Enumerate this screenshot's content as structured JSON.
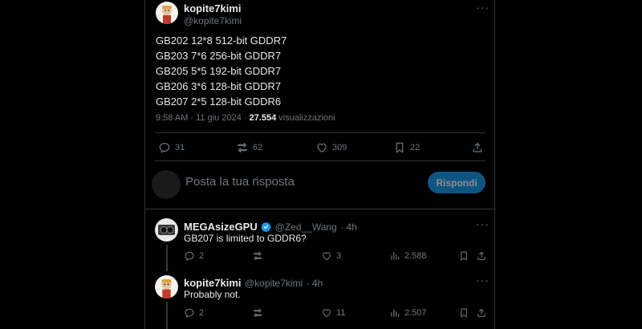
{
  "tweet": {
    "author_name": "kopite7kimi",
    "author_handle": "@kopite7kimi",
    "lines": [
      "GB202 12*8 512-bit GDDR7",
      "GB203 7*6 256-bit GDDR7",
      "GB205 5*5 192-bit GDDR7",
      "GB206 3*6 128-bit GDDR7",
      "GB207 2*5 128-bit GDDR6"
    ],
    "time": "9:58 AM · 11 giu 2024 · ",
    "views_count": "27.554",
    "views_label": " visualizzazioni",
    "actions": {
      "replies": "31",
      "reposts": "62",
      "likes": "309",
      "bookmarks": "22"
    }
  },
  "composer": {
    "placeholder": "Posta la tua risposta",
    "reply_button": "Rispondi"
  },
  "replies": [
    {
      "author_name": "MEGAsizeGPU",
      "author_handle": "@Zed__Wang",
      "time": "· 4h",
      "text": "GB207 is limited to GDDR6?",
      "actions": {
        "replies": "2",
        "reposts": "",
        "likes": "3",
        "views": "2.588"
      }
    },
    {
      "author_name": "kopite7kimi",
      "author_handle": "@kopite7kimi",
      "time": "· 4h",
      "text": "Probably not.",
      "actions": {
        "replies": "2",
        "reposts": "",
        "likes": "11",
        "views": "2.507"
      }
    }
  ],
  "colors": {
    "accent": "#1d9bf0",
    "muted": "#71767b",
    "text": "#e7e9ea",
    "border": "#2f3336"
  },
  "icons": [
    "reply-icon",
    "repost-icon",
    "like-icon",
    "bookmark-icon",
    "share-icon",
    "views-icon",
    "more-icon",
    "verified-icon"
  ]
}
